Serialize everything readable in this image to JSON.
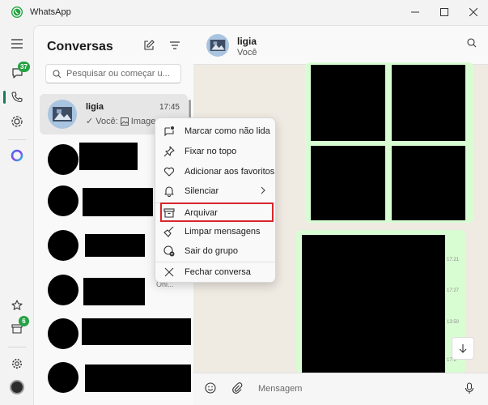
{
  "window": {
    "title": "WhatsApp"
  },
  "rail": {
    "chats_badge": "37",
    "archive_badge": "6"
  },
  "list": {
    "title": "Conversas",
    "search_placeholder": "Pesquisar ou começar u...",
    "selected_chat": {
      "name": "ligia",
      "time": "17:45",
      "preview_sender": "✓ Você:",
      "preview_text": "Imagem"
    },
    "partial_label": "Onl..."
  },
  "conversation": {
    "name": "ligia",
    "subtitle": "Você",
    "message_times": [
      "17:21",
      "17:27",
      "13:50",
      "17:3"
    ],
    "composer_placeholder": "Mensagem"
  },
  "context_menu": {
    "items": [
      {
        "label": "Marcar como não lida",
        "icon": "mark-unread-icon"
      },
      {
        "label": "Fixar no topo",
        "icon": "pin-icon"
      },
      {
        "label": "Adicionar aos favoritos",
        "icon": "heart-icon"
      },
      {
        "label": "Silenciar",
        "icon": "bell-icon"
      },
      {
        "label": "Arquivar",
        "icon": "archive-icon"
      },
      {
        "label": "Limpar mensagens",
        "icon": "broom-icon"
      },
      {
        "label": "Sair do grupo",
        "icon": "exit-group-icon"
      },
      {
        "label": "Fechar conversa",
        "icon": "close-icon"
      }
    ],
    "highlighted_item": "Arquivar"
  },
  "colors": {
    "accent": "#25a244",
    "highlight_border": "#d7262c",
    "bubble": "#d9fdd3",
    "wallpaper": "#efeae2"
  }
}
